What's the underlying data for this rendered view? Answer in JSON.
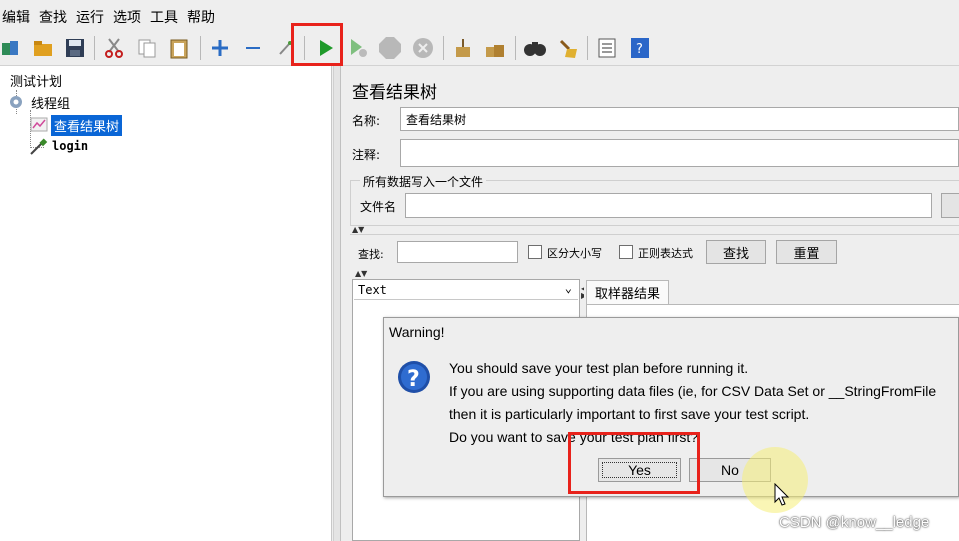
{
  "menu": [
    "编辑",
    "查找",
    "运行",
    "选项",
    "工具",
    "帮助"
  ],
  "toolbar": {
    "icons": [
      "templates-icon",
      "open-icon",
      "save-icon",
      "cut-icon",
      "copy-icon",
      "paste-icon",
      "expand-icon",
      "collapse-icon",
      "toggle-icon",
      "start-icon",
      "start-no-pause-icon",
      "stop-icon",
      "shutdown-icon",
      "clear-icon",
      "clear-all-icon",
      "search-icon",
      "reset-search-icon",
      "function-helper-icon",
      "help-icon"
    ],
    "run_color": "#1f9a2a",
    "highlight_color": "#e8221b"
  },
  "tree": {
    "root": "测试计划",
    "thread_group": "线程组",
    "selected": "查看结果树",
    "sampler": "login"
  },
  "panel": {
    "title": "查看结果树",
    "name_label": "名称:",
    "name_value": "查看结果树",
    "comment_label": "注释:",
    "comment_value": "",
    "file_group_title": "所有数据写入一个文件",
    "file_label": "文件名",
    "file_value": ""
  },
  "search": {
    "label": "查找:",
    "value": "",
    "case_label": "区分大小写",
    "regex_label": "正则表达式",
    "find_button": "查找",
    "reset_button": "重置"
  },
  "results": {
    "renderer": "Text",
    "tab": "取样器结果"
  },
  "dialog": {
    "title": "Warning!",
    "lines": [
      "You should save your test plan before running it.",
      "If you are using supporting data files (ie, for CSV Data Set or __StringFromFile",
      "then it is particularly important to first save your test script.",
      "Do you want to save your test plan first?"
    ],
    "yes_label": "Yes",
    "no_label": "No"
  },
  "watermark": "CSDN @know__ledge"
}
